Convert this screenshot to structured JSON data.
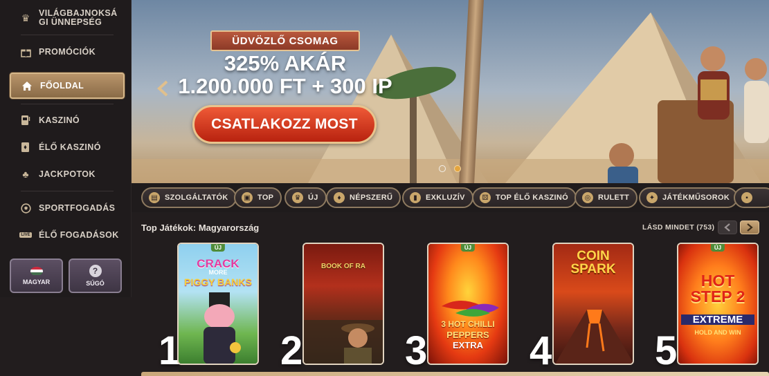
{
  "sidebar": {
    "items": [
      {
        "label": "VILÁGBAJNOKSÁ GI ÜNNEPSÉG",
        "icon": "trophy-icon"
      },
      {
        "label": "PROMÓCIÓK",
        "icon": "gift-icon"
      },
      {
        "label": "FŐOLDAL",
        "icon": "home-icon",
        "active": true
      },
      {
        "label": "KASZINÓ",
        "icon": "slot-machine-icon"
      },
      {
        "label": "ÉLŐ KASZINÓ",
        "icon": "cards-icon"
      },
      {
        "label": "JACKPOTOK",
        "icon": "clover-icon"
      },
      {
        "label": "SPORTFOGADÁS",
        "icon": "soccer-ball-icon"
      },
      {
        "label": "ÉLŐ FOGADÁSOK",
        "icon": "live-icon",
        "icon_text": "LIVE"
      }
    ],
    "language_label": "MAGYAR",
    "help_label": "SÚGÓ"
  },
  "banner": {
    "ribbon": "ÜDVÖZLŐ CSOMAG",
    "line1": "325% AKÁR",
    "line2": "1.200.000 FT + 300 IP",
    "cta": "CSATLAKOZZ MOST",
    "slides": 2,
    "active_slide": 2
  },
  "categories": [
    {
      "label": "SZOLGÁLTATÓK",
      "icon": "scroll-icon"
    },
    {
      "label": "TOP",
      "icon": "chest-icon"
    },
    {
      "label": "ÚJ",
      "icon": "trophy-icon"
    },
    {
      "label": "NÉPSZERŰ",
      "icon": "flame-icon"
    },
    {
      "label": "EXKLUZÍV",
      "icon": "book-icon"
    },
    {
      "label": "TOP ÉLŐ KASZINÓ",
      "icon": "dice-icon"
    },
    {
      "label": "RULETT",
      "icon": "roulette-icon"
    },
    {
      "label": "JÁTÉKMŰSOROK",
      "icon": "star-wheel-icon"
    }
  ],
  "top_games": {
    "title": "Top Játékok: Magyarország",
    "see_all": "LÁSD MINDET (753)",
    "new_badge": "ÚJ",
    "games": [
      {
        "rank": "1",
        "title_a": "CRACK",
        "title_b": "MORE",
        "title_c": "PIGGY BANKS",
        "new": true
      },
      {
        "rank": "2",
        "title_a": "BOOK OF RA",
        "new": false
      },
      {
        "rank": "3",
        "title_a": "3 HOT CHILLI",
        "title_b": "PEPPERS",
        "title_c": "EXTRA",
        "new": true
      },
      {
        "rank": "4",
        "title_a": "COIN",
        "title_b": "SPARK",
        "new": false
      },
      {
        "rank": "5",
        "title_a": "HOT STEP 2",
        "title_b": "EXTREME",
        "title_c": "HOLD AND WIN",
        "new": true
      }
    ]
  }
}
